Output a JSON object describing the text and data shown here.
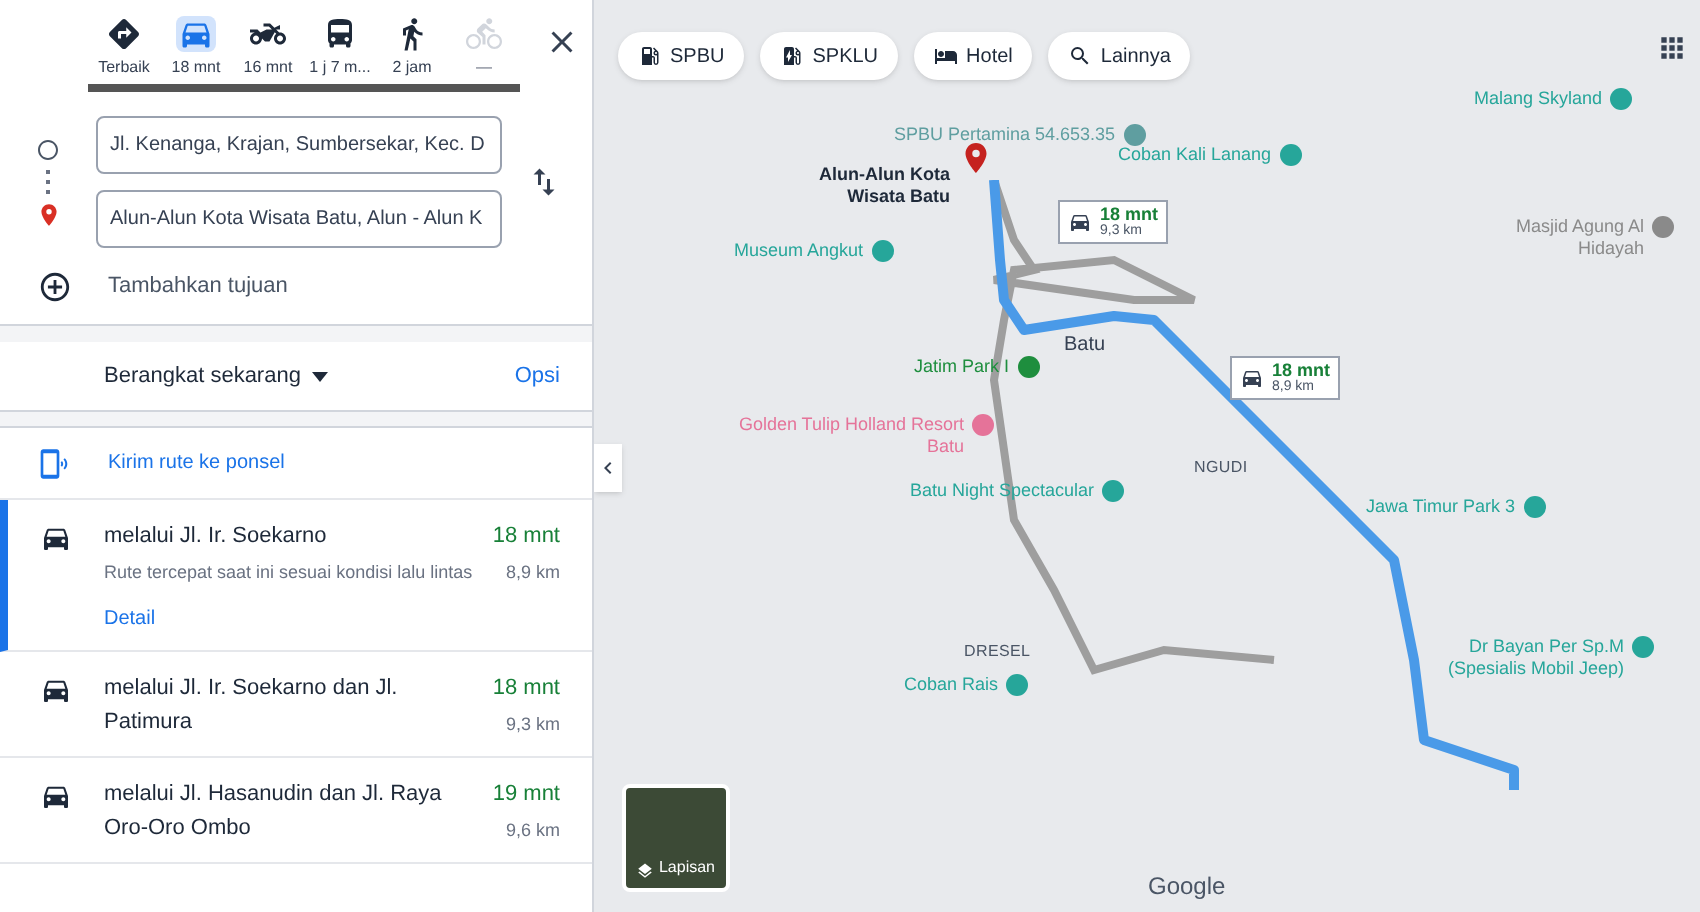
{
  "travel_modes": [
    {
      "kind": "best",
      "label": "Terbaik",
      "selected": false,
      "disabled": false
    },
    {
      "kind": "car",
      "label": "18 mnt",
      "selected": true,
      "disabled": false
    },
    {
      "kind": "motorbike",
      "label": "16 mnt",
      "selected": false,
      "disabled": false
    },
    {
      "kind": "transit",
      "label": "1 j 7 m...",
      "selected": false,
      "disabled": false
    },
    {
      "kind": "walk",
      "label": "2 jam",
      "selected": false,
      "disabled": false
    },
    {
      "kind": "bike",
      "label": "—",
      "selected": false,
      "disabled": true
    }
  ],
  "origin": {
    "value": "Jl. Kenanga, Krajan, Sumbersekar, Kec. D"
  },
  "destination": {
    "value": "Alun-Alun Kota Wisata Batu, Alun - Alun K"
  },
  "add_destination": "Tambahkan tujuan",
  "depart": {
    "label": "Berangkat sekarang",
    "options": "Opsi"
  },
  "send_to_phone": "Kirim rute ke ponsel",
  "routes": [
    {
      "title": "melalui Jl. Ir. Soekarno",
      "duration": "18 mnt",
      "distance": "8,9 km",
      "note": "Rute tercepat saat ini sesuai kondisi lalu lintas",
      "link": "Detail",
      "selected": true
    },
    {
      "title": "melalui Jl. Ir. Soekarno dan Jl. Patimura",
      "duration": "18 mnt",
      "distance": "9,3 km",
      "selected": false
    },
    {
      "title": "melalui Jl. Hasanudin dan Jl. Raya Oro-Oro Ombo",
      "duration": "19 mnt",
      "distance": "9,6 km",
      "selected": false
    }
  ],
  "map": {
    "chips": [
      {
        "kind": "fuel",
        "label": "SPBU"
      },
      {
        "kind": "charging",
        "label": "SPKLU"
      },
      {
        "kind": "hotel",
        "label": "Hotel"
      },
      {
        "kind": "search",
        "label": "Lainnya"
      }
    ],
    "places": [
      {
        "kind": "poi",
        "label": "SPBU Pertamina 54.653.35",
        "color": "#5f9ea0"
      },
      {
        "kind": "destination",
        "label": "Alun-Alun Kota Wisata Batu"
      },
      {
        "kind": "poi",
        "label": "Museum Angkut",
        "color": "#26a69a"
      },
      {
        "kind": "poi",
        "label": "Jatim Park I",
        "color": "#1e8e3e"
      },
      {
        "kind": "poi",
        "label": "Golden Tulip Holland Resort Batu",
        "color": "#e57399"
      },
      {
        "kind": "poi",
        "label": "Batu Night Spectacular",
        "color": "#26a69a"
      },
      {
        "kind": "poi",
        "label": "Coban Kali Lanang",
        "color": "#26a69a"
      },
      {
        "kind": "poi",
        "label": "Malang Skyland",
        "color": "#26a69a"
      },
      {
        "kind": "poi",
        "label": "Masjid Agung Al Hidayah",
        "color": "#8a8a8a"
      },
      {
        "kind": "poi",
        "label": "Jawa Timur Park 3",
        "color": "#26a69a"
      },
      {
        "kind": "poi",
        "label": "Dr Bayan Per Sp.M (Spesialis Mobil Jeep)",
        "color": "#26a69a"
      },
      {
        "kind": "poi",
        "label": "Coban Rais",
        "color": "#26a69a"
      },
      {
        "kind": "area",
        "label": "Batu"
      },
      {
        "kind": "district",
        "label": "NGUDI"
      },
      {
        "kind": "district",
        "label": "DRESEL"
      }
    ],
    "route_labels": [
      {
        "duration": "18 mnt",
        "distance": "9,3 km"
      },
      {
        "duration": "18 mnt",
        "distance": "8,9 km"
      }
    ],
    "layers": "Lapisan",
    "attribution": "Google"
  }
}
